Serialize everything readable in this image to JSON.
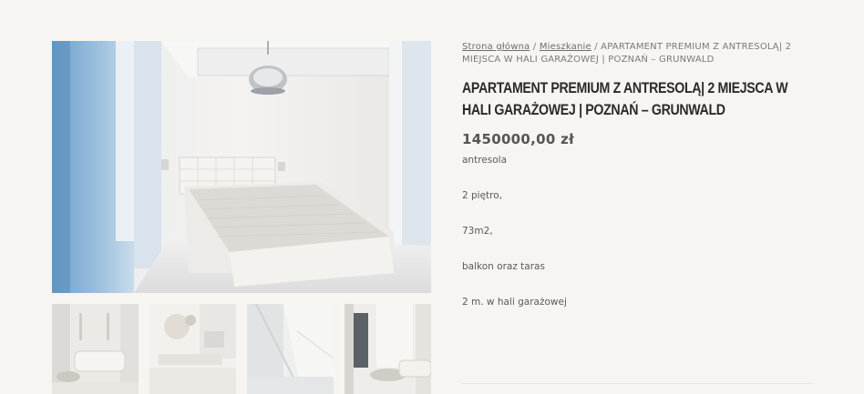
{
  "breadcrumb": {
    "home": "Strona główna",
    "sep1": " / ",
    "category": "Mieszkanie",
    "sep2": " / ",
    "current": "APARTAMENT PREMIUM Z ANTRESOLĄ| 2 MIEJSCA W HALI GARAŻOWEJ | POZNAŃ – GRUNWALD"
  },
  "product": {
    "title": "APARTAMENT PREMIUM Z ANTRESOLĄ| 2 MIEJSCA W HALI GARAŻOWEJ | POZNAŃ – GRUNWALD",
    "price": "1450000,00 zł",
    "description": [
      "antresola",
      "2 piętro,",
      "73m2,",
      "balkon oraz taras",
      "2 m. w hali garażowej"
    ]
  },
  "gallery": {
    "main_image": "bedroom-photo",
    "thumbnails": [
      "living-room-sofa-photo",
      "living-room-chandelier-photo",
      "glass-staircase-photo",
      "living-room-window-photo"
    ]
  }
}
